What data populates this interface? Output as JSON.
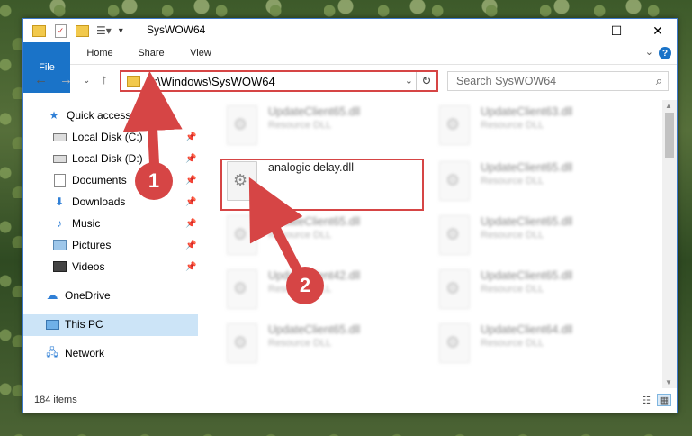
{
  "window": {
    "title": "SysWOW64",
    "controls": {
      "minimize": "—",
      "maximize": "☐",
      "close": "✕"
    }
  },
  "ribbon": {
    "tabs": [
      "File",
      "Home",
      "Share",
      "View"
    ],
    "help": "?"
  },
  "address_bar": {
    "path": "C:\\Windows\\SysWOW64"
  },
  "search": {
    "placeholder": "Search SysWOW64"
  },
  "sidebar": {
    "quick_access": "Quick access",
    "items": [
      {
        "label": "Local Disk (C:)",
        "icon": "drive-icon"
      },
      {
        "label": "Local Disk (D:)",
        "icon": "drive-icon"
      },
      {
        "label": "Documents",
        "icon": "documents-icon"
      },
      {
        "label": "Downloads",
        "icon": "downloads-icon"
      },
      {
        "label": "Music",
        "icon": "music-icon"
      },
      {
        "label": "Pictures",
        "icon": "pictures-icon"
      },
      {
        "label": "Videos",
        "icon": "videos-icon"
      }
    ],
    "onedrive": "OneDrive",
    "this_pc": "This PC",
    "network": "Network"
  },
  "files": {
    "highlighted": {
      "name": "analogic delay.dll"
    },
    "blurred": [
      {
        "name": "UpdateClient65.dll",
        "type": "Resource DLL"
      },
      {
        "name": "UpdateClient63.dll",
        "type": "Resource DLL"
      },
      {
        "name": "UpdateClient65.dll",
        "type": "Resource DLL"
      },
      {
        "name": "UpdateClient65.dll",
        "type": "Resource DLL"
      },
      {
        "name": "UpdateClient65.dll",
        "type": "Resource DLL"
      },
      {
        "name": "UpdateClient42.dll",
        "type": "Resource DLL"
      },
      {
        "name": "UpdateClient65.dll",
        "type": "Resource DLL"
      },
      {
        "name": "UpdateClient65.dll",
        "type": "Resource DLL"
      },
      {
        "name": "UpdateClient64.dll",
        "type": "Resource DLL"
      }
    ]
  },
  "status": {
    "item_count": "184 items"
  },
  "annotations": {
    "step1": "1",
    "step2": "2",
    "color": "#d64545"
  }
}
